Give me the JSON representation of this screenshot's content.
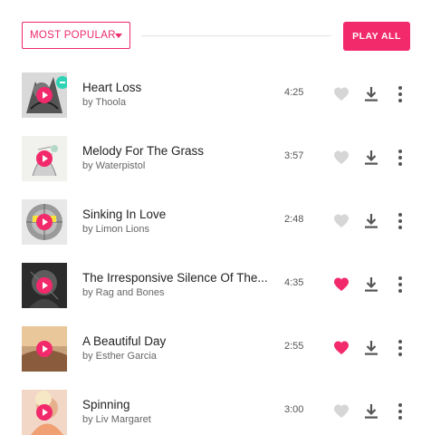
{
  "toolbar": {
    "sort_label": "MOST POPULAR",
    "sort_icon": "caret-down-icon",
    "play_all_label": "PLAY ALL"
  },
  "colors": {
    "accent": "#f2296b",
    "heart_active": "#f2296b",
    "heart_inactive": "#d6d6d6",
    "icon": "#555555",
    "badge": "#2fd3b5"
  },
  "tracks": [
    {
      "title": "Heart Loss",
      "artist": "by Thoola",
      "duration": "4:25",
      "liked": false,
      "badge": true
    },
    {
      "title": "Melody For The Grass",
      "artist": "by Waterpistol",
      "duration": "3:57",
      "liked": false,
      "badge": false
    },
    {
      "title": "Sinking In Love",
      "artist": "by Limon Lions",
      "duration": "2:48",
      "liked": false,
      "badge": false
    },
    {
      "title": "The Irresponsive Silence Of The...",
      "artist": "by Rag and Bones",
      "duration": "4:35",
      "liked": true,
      "badge": false
    },
    {
      "title": "A Beautiful Day",
      "artist": "by Esther Garcia",
      "duration": "2:55",
      "liked": true,
      "badge": false
    },
    {
      "title": "Spinning",
      "artist": "by Liv Margaret",
      "duration": "3:00",
      "liked": false,
      "badge": false
    }
  ]
}
